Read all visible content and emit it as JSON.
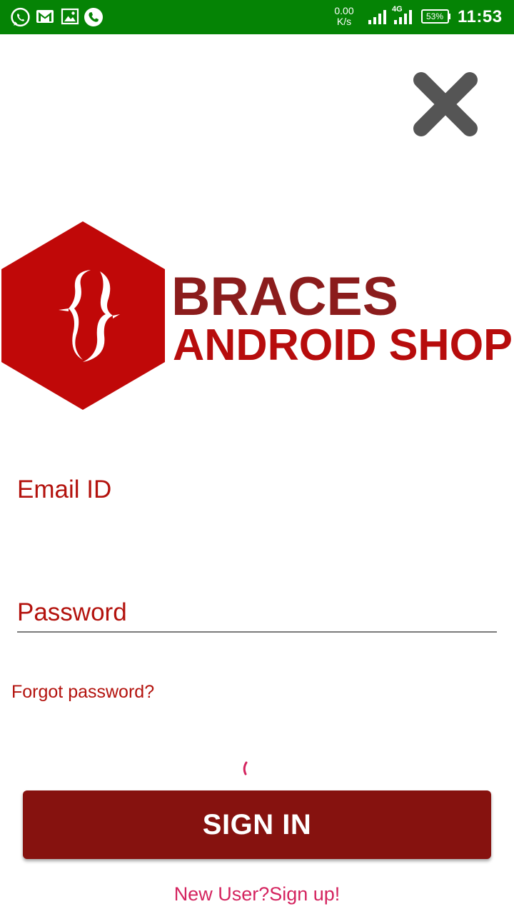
{
  "status_bar": {
    "icons": [
      "whatsapp-icon",
      "gmail-icon",
      "gallery-icon",
      "phone-call-icon"
    ],
    "network_speed_value": "0.00",
    "network_speed_unit": "K/s",
    "network_type": "4G",
    "battery": "53%",
    "time": "11:53",
    "color": "#058305"
  },
  "close": {
    "icon": "close-icon",
    "color": "#555555"
  },
  "logo": {
    "line1": "BRACES",
    "line2": "ANDROID SHOP",
    "line1_color": "#8b1c1c",
    "line2_color": "#b70c0c",
    "hex_color": "#c00808"
  },
  "form": {
    "email_label": "Email ID",
    "password_label": "Password",
    "forgot_password": "Forgot password?",
    "sign_in_label": "SIGN IN",
    "signup_link": "New User?Sign up!"
  },
  "colors": {
    "accent_red": "#b3120d",
    "button": "#86120f",
    "link_pink": "#d4245f"
  }
}
